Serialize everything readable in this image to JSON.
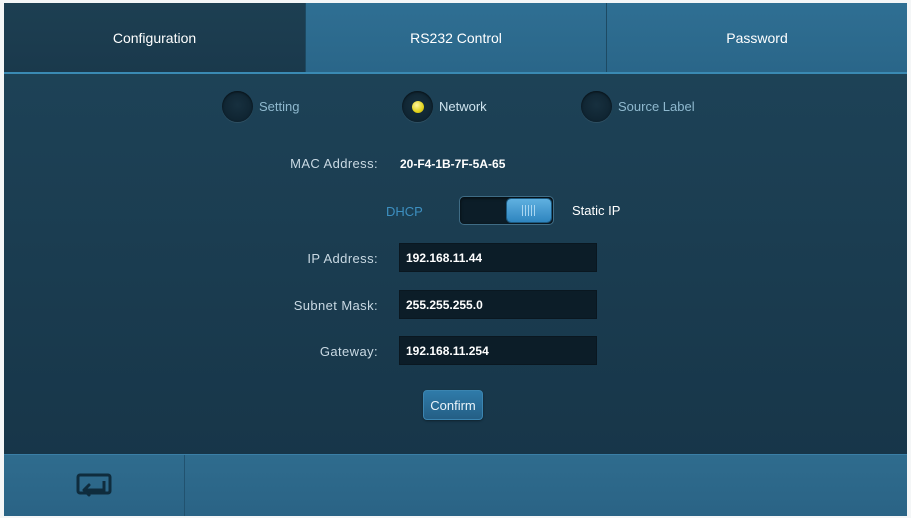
{
  "tabs": [
    {
      "label": "Configuration",
      "active": true
    },
    {
      "label": "RS232 Control",
      "active": false
    },
    {
      "label": "Password",
      "active": false
    }
  ],
  "subtabs": [
    {
      "label": "Setting",
      "selected": false
    },
    {
      "label": "Network",
      "selected": true
    },
    {
      "label": "Source Label",
      "selected": false
    }
  ],
  "network": {
    "mac_label": "MAC Address:",
    "mac_value": "20-F4-1B-7F-5A-65",
    "mode_left": "DHCP",
    "mode_right": "Static IP",
    "mode_selected": "Static IP",
    "ip_label": "IP Address:",
    "ip_value": "192.168.11.44",
    "subnet_label": "Subnet Mask:",
    "subnet_value": "255.255.255.0",
    "gateway_label": "Gateway:",
    "gateway_value": "192.168.11.254",
    "confirm_label": "Confirm"
  },
  "footer": {
    "back_icon": "return-icon"
  },
  "colors": {
    "panel": "#1b3d51",
    "tab": "#2f6f93",
    "accent": "#3d8fc0",
    "radio_selected": "#e2d21b"
  }
}
